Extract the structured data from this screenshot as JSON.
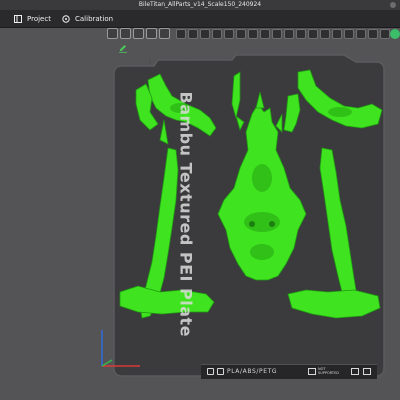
{
  "window": {
    "title": "BileTitan_AllParts_v14_Scale150_240924"
  },
  "tabs": [
    {
      "label": "Project"
    },
    {
      "label": "Calibration"
    }
  ],
  "plate": {
    "name": "Bambu Textured PEI Plate",
    "filament_label": "PLA/ABS/PETG",
    "note_line1": "NOT",
    "note_line2": "SUPPORTED"
  },
  "colors": {
    "model": "#3fe31f",
    "model_dark": "#1f9a12",
    "plate": "#3b3b3d",
    "background": "#545457",
    "accent": "#3bbd6a"
  },
  "icons": [
    "project-icon",
    "calibration-icon",
    "add-object-icon",
    "rotate-icon",
    "arrange-icon",
    "layers-icon",
    "edit-icon",
    "status-dot-icon"
  ]
}
